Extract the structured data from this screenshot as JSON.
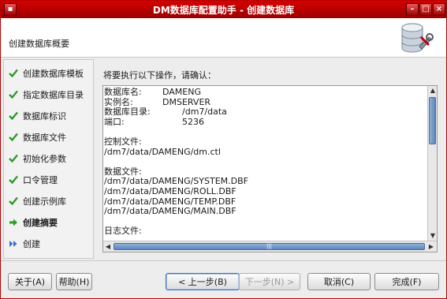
{
  "window": {
    "title": "DM数据库配置助手 - 创建数据库"
  },
  "header": {
    "title": "创建数据库概要",
    "icon": "database-wrench-icon"
  },
  "sidebar": {
    "items": [
      {
        "label": "创建数据库模板",
        "state": "done"
      },
      {
        "label": "指定数据库目录",
        "state": "done"
      },
      {
        "label": "数据库标识",
        "state": "done"
      },
      {
        "label": "数据库文件",
        "state": "done"
      },
      {
        "label": "初始化参数",
        "state": "done"
      },
      {
        "label": "口令管理",
        "state": "done"
      },
      {
        "label": "创建示例库",
        "state": "done"
      },
      {
        "label": "创建摘要",
        "state": "current"
      },
      {
        "label": "创建",
        "state": "pending"
      }
    ]
  },
  "summary": {
    "prompt": "将要执行以下操作，请确认：",
    "db_name_label": "数据库名:",
    "db_name": "DAMENG",
    "instance_label": "实例名:",
    "instance": "DMSERVER",
    "dir_label": "数据库目录:",
    "dir": "/dm7/data",
    "port_label": "端口:",
    "port": "5236",
    "control_label": "控制文件:",
    "control_file": "/dm7/data/DAMENG/dm.ctl",
    "data_label": "数据文件:",
    "data_files": [
      "/dm7/data/DAMENG/SYSTEM.DBF",
      "/dm7/data/DAMENG/ROLL.DBF",
      "/dm7/data/DAMENG/TEMP.DBF",
      "/dm7/data/DAMENG/MAIN.DBF"
    ],
    "log_label": "日志文件:"
  },
  "buttons": {
    "about": "关于(A)",
    "help": "帮助(H)",
    "back": "< 上一步(B)",
    "next": "下一步(N) >",
    "cancel": "取消(C)",
    "finish": "完成(F)"
  },
  "colors": {
    "titlebar": "#c00000",
    "check": "#2e9a2e",
    "arrow": "#2e9a2e",
    "pending": "#3a6fd0"
  }
}
